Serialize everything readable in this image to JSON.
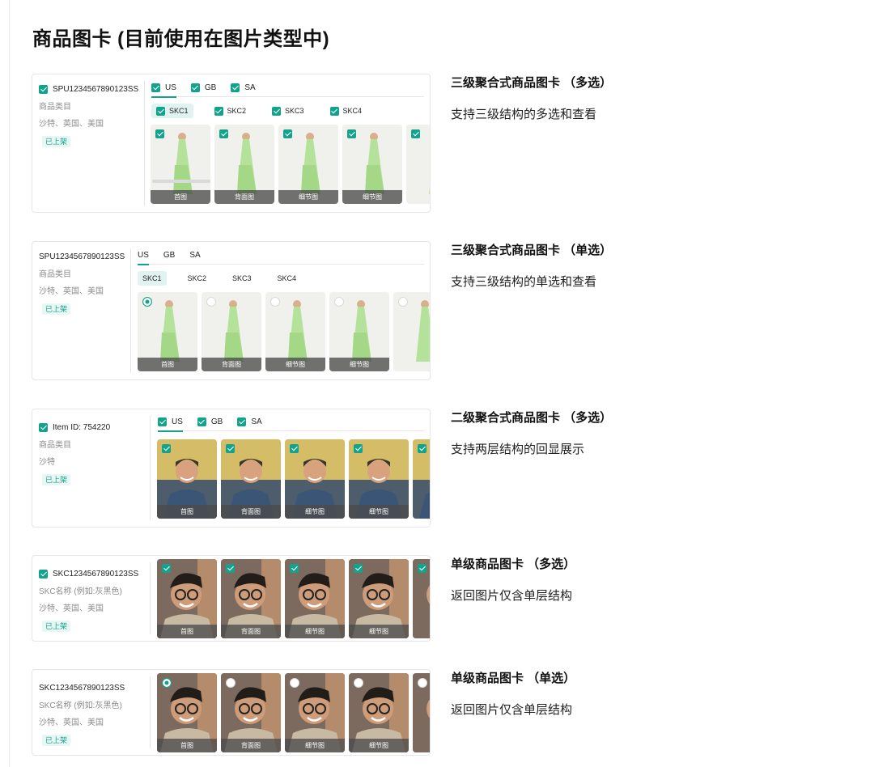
{
  "page_title": "商品图卡 (目前使用在图片类型中)",
  "colors": {
    "accent": "#13a38c",
    "badge_bg": "#e8f7f4",
    "caption_bg": "#4b4b4b"
  },
  "cards": [
    {
      "id_text": "SPU1234567890123SS",
      "meta1": "商品类目",
      "meta2": "沙特、英国、美国",
      "status": "已上架",
      "regions": [
        "US",
        "GB",
        "SA"
      ],
      "skcs": [
        "SKC1",
        "SKC2",
        "SKC3",
        "SKC4"
      ],
      "captions": [
        "首图",
        "背面图",
        "细节图",
        "细节图",
        ""
      ],
      "desc_title": "三级聚合式商品图卡 （多选）",
      "desc_text": "支持三级结构的多选和查看"
    },
    {
      "id_text": "SPU1234567890123SS",
      "meta1": "商品类目",
      "meta2": "沙特、英国、美国",
      "status": "已上架",
      "regions": [
        "US",
        "GB",
        "SA"
      ],
      "skcs": [
        "SKC1",
        "SKC2",
        "SKC3",
        "SKC4"
      ],
      "captions": [
        "首图",
        "背面图",
        "细节图",
        "细节图",
        ""
      ],
      "desc_title": "三级聚合式商品图卡 （单选）",
      "desc_text": "支持三级结构的单选和查看"
    },
    {
      "id_text": "Item ID: 754220",
      "meta1": "商品类目",
      "meta2": "沙特",
      "status": "已上架",
      "regions": [
        "US",
        "GB",
        "SA"
      ],
      "captions": [
        "首图",
        "背面图",
        "细节图",
        "细节图",
        ""
      ],
      "desc_title": "二级聚合式商品图卡 （多选）",
      "desc_text": "支持两层结构的回显展示"
    },
    {
      "id_text": "SKC1234567890123SS",
      "meta1": "SKC名称 (例如:灰黑色)",
      "meta2": "沙特、英国、美国",
      "status": "已上架",
      "captions": [
        "首图",
        "背面图",
        "细节图",
        "细节图",
        ""
      ],
      "desc_title": "单级商品图卡 （多选）",
      "desc_text": "返回图片仅含单层结构"
    },
    {
      "id_text": "SKC1234567890123SS",
      "meta1": "SKC名称 (例如:灰黑色)",
      "meta2": "沙特、英国、美国",
      "status": "已上架",
      "captions": [
        "首图",
        "背面图",
        "细节图",
        "细节图",
        ""
      ],
      "desc_title": "单级商品图卡 （单选）",
      "desc_text": "返回图片仅含单层结构"
    }
  ]
}
